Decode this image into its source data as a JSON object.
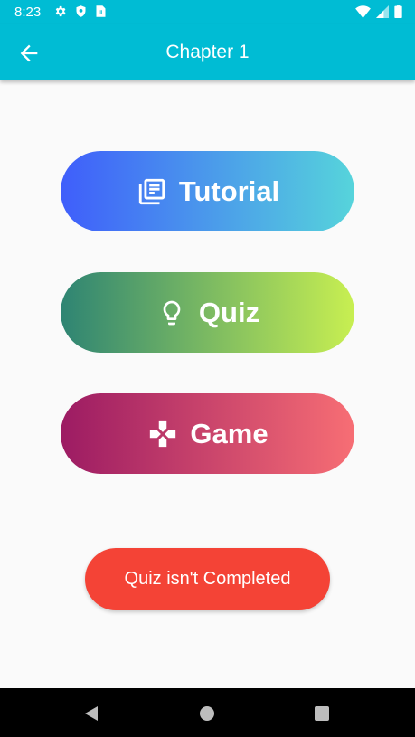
{
  "status_bar": {
    "time": "8:23",
    "left_icons": [
      "settings-icon",
      "shield-icon",
      "sim-card-icon"
    ],
    "right_icons": [
      "wifi-icon",
      "signal-icon",
      "battery-icon"
    ]
  },
  "app_bar": {
    "title": "Chapter 1",
    "back_icon": "arrow-back-icon",
    "color": "#00bcd4"
  },
  "menu": {
    "tutorial": {
      "label": "Tutorial",
      "icon": "library-books-icon",
      "gradient": [
        "#3f5efb",
        "#56d4db"
      ]
    },
    "quiz": {
      "label": "Quiz",
      "icon": "lightbulb-icon",
      "gradient": [
        "#2e8473",
        "#c8ef51"
      ]
    },
    "game": {
      "label": "Game",
      "icon": "gamepad-icon",
      "gradient": [
        "#9c1b63",
        "#f76e74"
      ]
    }
  },
  "quiz_status": {
    "label": "Quiz isn't Completed",
    "color": "#f44336"
  },
  "nav_bar": {
    "icons": [
      "nav-back-icon",
      "nav-home-icon",
      "nav-recents-icon"
    ]
  }
}
